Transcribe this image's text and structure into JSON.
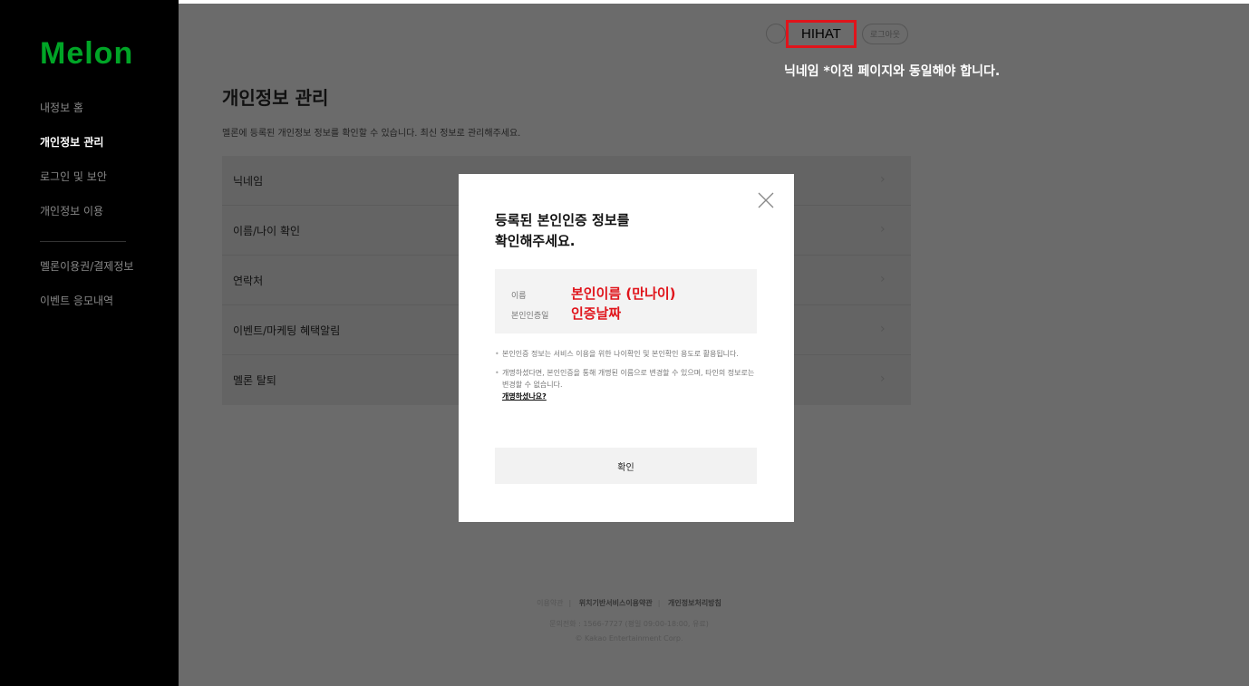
{
  "brand": {
    "logo_text": "Melon",
    "logo_color": "#00a526"
  },
  "sidebar": {
    "items": [
      {
        "label": "내정보 홈",
        "active": false
      },
      {
        "label": "개인정보 관리",
        "active": true
      },
      {
        "label": "로그인 및 보안",
        "active": false
      },
      {
        "label": "개인정보 이용",
        "active": false
      }
    ],
    "items2": [
      {
        "label": "멜론이용권/결제정보"
      },
      {
        "label": "이벤트 응모내역"
      }
    ]
  },
  "header": {
    "nickname": "HIHAT",
    "logout_label": "로그아웃",
    "annotation": "닉네임 *이전 페이지와 동일해야 합니다.",
    "highlight_color": "#e0141b"
  },
  "page": {
    "title": "개인정보 관리",
    "description": "멜론에 등록된 개인정보 정보를 확인할 수 있습니다. 최신 정보로 관리해주세요."
  },
  "settings": [
    {
      "label": "닉네임"
    },
    {
      "label": "이름/나이 확인"
    },
    {
      "label": "연락처"
    },
    {
      "label": "이벤트/마케팅 혜택알림"
    },
    {
      "label": "멜론 탈퇴"
    }
  ],
  "modal": {
    "title_line1": "등록된 본인인증 정보를",
    "title_line2": "확인해주세요.",
    "name_label": "이름",
    "name_value": "본인이름 (만나이)",
    "date_label": "본인인증일",
    "date_value": "인증날짜",
    "note1": "본인인증 정보는 서비스 이용을 위한 나이확인 및 본인확인 용도로 활용됩니다.",
    "note2": "개명하셨다면, 본인인증을 통해 개명된 이름으로 변경할 수 있으며, 타인의 정보로는 변경할 수 없습니다.",
    "note2_link": "개명하셨나요?",
    "confirm_label": "확인"
  },
  "footer": {
    "link1": "이용약관",
    "link2": "위치기반서비스이용약관",
    "link3": "개인정보처리방침",
    "contact": "문의전화 : 1566-7727 (평일 09:00-18:00, 유료)",
    "copyright": "© Kakao Entertainment Corp."
  }
}
